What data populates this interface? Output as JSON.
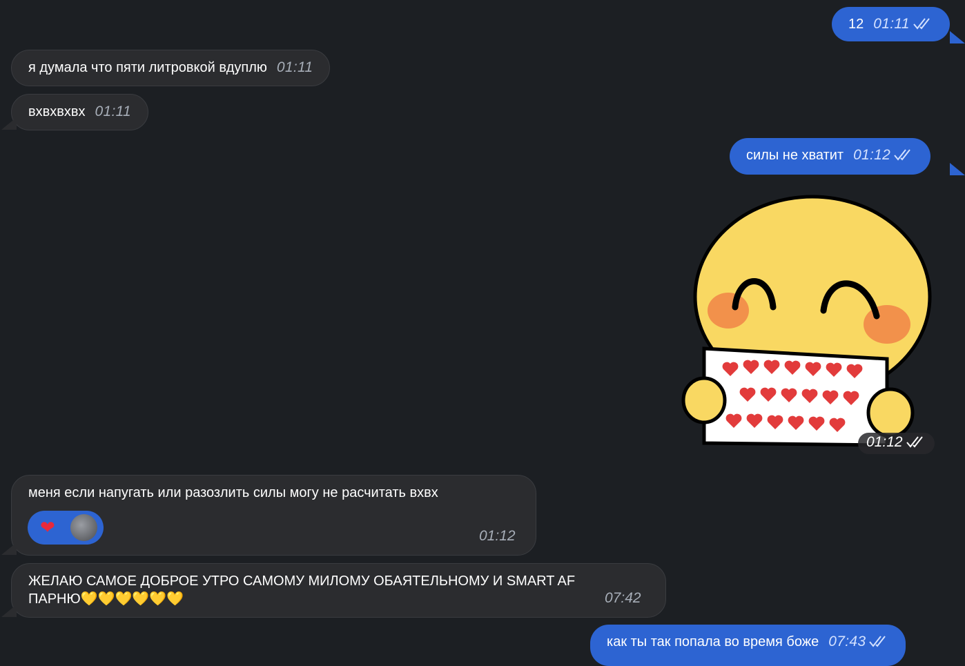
{
  "messages": [
    {
      "id": "m1",
      "direction": "out",
      "text": "12",
      "time": "01:11"
    },
    {
      "id": "m2",
      "direction": "in",
      "text": "я думала что пяти литровкой вдуплю",
      "time": "01:11"
    },
    {
      "id": "m3",
      "direction": "in",
      "text": "вхвхвхвх",
      "time": "01:11"
    },
    {
      "id": "m4",
      "direction": "out",
      "text": "силы не хватит",
      "time": "01:12"
    },
    {
      "id": "m5",
      "direction": "out",
      "type": "sticker",
      "sticker": "smiling-emoji-with-hearts-sign",
      "time": "01:12"
    },
    {
      "id": "m6",
      "direction": "in",
      "text": "меня если напугать или разозлить силы могу не расчитать вхвх",
      "time": "01:12",
      "reaction": {
        "emoji": "❤️",
        "icon": "heart-reaction-icon"
      }
    },
    {
      "id": "m7",
      "direction": "in",
      "text_line1": "ЖЕЛАЮ САМОЕ ДОБРОЕ УТРО САМОМУ МИЛОМУ ОБАЯТЕЛЬНОМУ И SMART AF",
      "text_line2": "ПАРНЮ💛💛💛💛💛💛",
      "time": "07:42"
    },
    {
      "id": "m8",
      "direction": "out",
      "text": "как ты так попала во время боже",
      "time": "07:43"
    }
  ],
  "colors": {
    "background": "#1c1f23",
    "incoming_bubble": "#2b2c2f",
    "outgoing_bubble": "#2d64d2"
  },
  "icons": {
    "read_receipt": "double-check-icon"
  }
}
